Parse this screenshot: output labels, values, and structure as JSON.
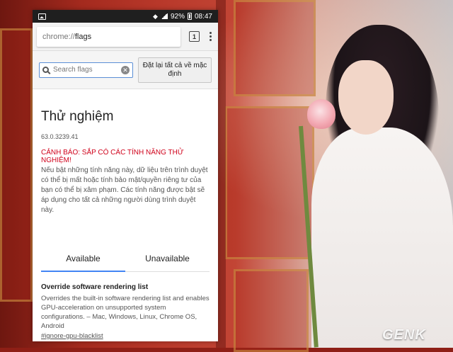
{
  "statusbar": {
    "battery": "92%",
    "time": "08:47"
  },
  "toolbar": {
    "url_scheme": "chrome://",
    "url_host": "flags",
    "tab_count": "1"
  },
  "flags_header": {
    "search_placeholder": "Search flags",
    "reset_button": "Đặt lại tất cả về mặc định"
  },
  "main": {
    "title": "Thử nghiệm",
    "version": "63.0.3239.41",
    "warning_title": "CẢNH BÁO: SẮP CÓ CÁC TÍNH NĂNG THỬ NGHIỆM!",
    "warning_text": "Nếu bật những tính năng này, dữ liệu trên trình duyệt có thể bị mất hoặc tính bảo mật/quyền riêng tư của bạn có thể bị xâm phạm. Các tính năng được bật sẽ áp dụng cho tất cả những người dùng trình duyệt này."
  },
  "tabs": [
    {
      "label": "Available",
      "active": true
    },
    {
      "label": "Unavailable",
      "active": false
    }
  ],
  "flags": [
    {
      "name": "Override software rendering list",
      "description": "Overrides the built-in software rendering list and enables GPU-acceleration on unsupported system configurations. – Mac, Windows, Linux, Chrome OS, Android",
      "link": "#ignore-gpu-blacklist"
    }
  ],
  "watermark": "GENK",
  "colors": {
    "accent": "#4285f4",
    "warning": "#d0021b"
  }
}
